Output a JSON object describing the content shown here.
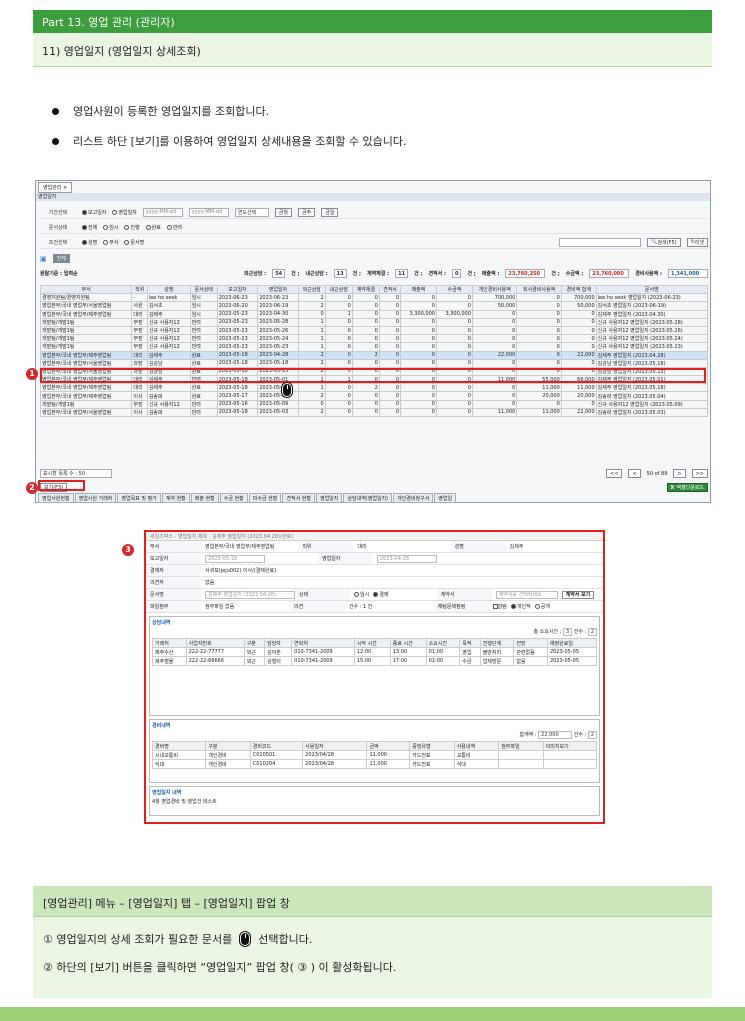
{
  "header": {
    "part": "Part 13. 영업 관리 (관리자)",
    "section": "11) 영업일지 (영업일지 상세조회)"
  },
  "bullets": [
    "영업사원이 등록한 영업일지를 조회합니다.",
    "리스트 하단 [보기]를 이용하여 영업일지 상세내용을 조회할 수 있습니다."
  ],
  "screen": {
    "tab": "영업관리 ×",
    "menu": "영업일지",
    "period_label": "기간선택",
    "period_opts": [
      "보고일자",
      "영업일자"
    ],
    "date_ph": "yyyy-MM-dd",
    "year_select": "연도선택",
    "btn_today": "금월",
    "btn_week": "금주",
    "btn_day": "금일",
    "doc_label": "문서상태",
    "doc_opts": [
      "전체",
      "임시",
      "진행",
      "완료",
      "반려"
    ],
    "cond_label": "조건선택",
    "cond_opts": [
      "성명",
      "부서",
      "문서명"
    ],
    "search_btn": "검색(F5)",
    "reset_btn": "리셋",
    "all_btn": "전체",
    "summary": {
      "base": "원탈기준 : 입력순",
      "visit_out": "외근상담 :",
      "visit_out_v": "54",
      "unit_case": "건 ;",
      "visit_in": "내근상담 :",
      "visit_in_v": "13",
      "contract": "계약체결 :",
      "contract_v": "11",
      "estimate": "견적서 :",
      "estimate_v": "0",
      "sales": "매출액 :",
      "sales_v": "23,760,250",
      "collect": "수금액 :",
      "collect_v": "23,760,000",
      "expense": "경비사용액 :",
      "expense_v": "1,341,000"
    },
    "columns": [
      "부서",
      "직위",
      "성명",
      "문서상태",
      "보고일자",
      "영업일자",
      "외근상담",
      "내근상담",
      "계약체결",
      "견적서",
      "매출액",
      "수금액",
      "개인경비사용액",
      "회사경비사용액",
      "경비액 합계",
      "문서명"
    ],
    "rows": [
      [
        "경영지원팀/경영지원팀",
        "-",
        "lee ho seok",
        "임시",
        "2023-06-23",
        "2023-06-23",
        "2",
        "0",
        "0",
        "0",
        "0",
        "0",
        "700,000",
        "0",
        "700,000",
        "lee ho seok 영업일지 (2023-06-23)"
      ],
      [
        "영업본부/국내 영업부/서울영업팀",
        "사원",
        "김서초",
        "임시",
        "2023-06-20",
        "2023-06-19",
        "2",
        "0",
        "0",
        "0",
        "0",
        "0",
        "50,000",
        "0",
        "50,000",
        "김서초 영업일지 (2023-06-19)"
      ],
      [
        "영업본부/국내 영업부/제주영업팀",
        "대리",
        "김제주",
        "임시",
        "2023-05-23",
        "2023-04-30",
        "0",
        "1",
        "0",
        "0",
        "3,300,000",
        "3,300,000",
        "0",
        "0",
        "0",
        "김제주 영업일지 (2023.04.30)"
      ],
      [
        "개발팀/개발1팀",
        "부장",
        "신규 사용자12",
        "반려",
        "2023-05-23",
        "2023-05-28",
        "1",
        "0",
        "0",
        "0",
        "0",
        "0",
        "0",
        "0",
        "0",
        "신규 사용자12 영업일지 (2023.05.28)"
      ],
      [
        "개발팀/개발1팀",
        "부장",
        "신규 사용자12",
        "반려",
        "2023-05-23",
        "2023-05-26",
        "1",
        "0",
        "0",
        "0",
        "0",
        "0",
        "0",
        "0",
        "0",
        "신규 사용자12 영업일지 (2023.05.26)"
      ],
      [
        "개발팀/개발1팀",
        "부장",
        "신규 사용자12",
        "반려",
        "2023-05-23",
        "2023-05-24",
        "1",
        "0",
        "0",
        "0",
        "0",
        "0",
        "0",
        "0",
        "0",
        "신규 사용자12 영업일지 (2023.05.24)"
      ],
      [
        "개발팀/개발1팀",
        "부장",
        "신규 사용자12",
        "반려",
        "2023-05-23",
        "2023-05-23",
        "1",
        "0",
        "0",
        "0",
        "0",
        "0",
        "0",
        "0",
        "0",
        "신규 사용자12 영업일지 (2023.05.23)"
      ],
      [
        "영업본부/국내 영업부/제주영업팀",
        "대리",
        "김제주",
        "완료",
        "2023-05-18",
        "2023-04-28",
        "2",
        "0",
        "2",
        "0",
        "0",
        "0",
        "22,000",
        "0",
        "22,000",
        "김제주 영업일지 (2023.04.28)"
      ],
      [
        "영업본부/국내 영업부/서울영업팀",
        "과장",
        "김강남",
        "완료",
        "2023-05-18",
        "2023-05-18",
        "2",
        "0",
        "0",
        "0",
        "0",
        "0",
        "0",
        "0",
        "0",
        "김강남 영업일지 (2023.05.18)"
      ],
      [
        "영업본부/국내 영업부/서울영업팀",
        "과장",
        "김강남",
        "완료",
        "2023-05-18",
        "2023-05-15",
        "2",
        "0",
        "0",
        "0",
        "0",
        "0",
        "0",
        "0",
        "0",
        "김강남 영업일지 (2023.05.15)"
      ],
      [
        "영업본부/국내 영업부/제주영업팀",
        "대리",
        "김제주",
        "반려",
        "2023-05-18",
        "2023-05-01",
        "1",
        "1",
        "0",
        "0",
        "0",
        "0",
        "11,000",
        "55,000",
        "66,000",
        "김제주 영업일지 (2023.05.01)"
      ],
      [
        "영업본부/국내 영업부/제주영업팀",
        "대리",
        "김제주",
        "완료",
        "2023-05-18",
        "2023-05-18",
        "1",
        "0",
        "2",
        "0",
        "0",
        "0",
        "0",
        "11,000",
        "11,000",
        "김제주 영업일지 (2023.05.18)"
      ],
      [
        "영업본부/국내 영업부/제주영업팀",
        "이사",
        "김송파",
        "완료",
        "2023-05-17",
        "2023-05-04",
        "2",
        "0",
        "0",
        "0",
        "0",
        "0",
        "0",
        "20,000",
        "20,000",
        "김송파 영업일지 (2023.05.04)"
      ],
      [
        "개발팀/개발1팀",
        "부장",
        "신규 사용자12",
        "반려",
        "2023-05-16",
        "2023-05-09",
        "0",
        "0",
        "0",
        "0",
        "0",
        "0",
        "0",
        "0",
        "0",
        "신규 사용자12 영업일지 (2023.05.09)"
      ],
      [
        "영업본부/국내 영업부/서울영업팀",
        "이사",
        "김송파",
        "반려",
        "2023-05-18",
        "2023-05-03",
        "2",
        "0",
        "0",
        "0",
        "0",
        "0",
        "11,000",
        "11,000",
        "22,000",
        "김송파 영업일지 (2023.05.03)"
      ]
    ],
    "rows_per_page": "표시할 목록 수 : 50",
    "pager": "50 of 89",
    "excel_btn": "엑셀다운로드",
    "view_btn": "보기(F3)",
    "bottom_tabs": [
      "영업사원현황",
      "영업사원 거래처",
      "영업목표 및 평가",
      "계약 현황",
      "매출 현황",
      "수금 현황",
      "미수금 현황",
      "견적서 현황",
      "영업일지",
      "상담내역(영업일지)",
      "개인경비청구서",
      "영업일"
    ]
  },
  "popup": {
    "title": "세일즈박스 - 영업일지 제목 : 김제주 영업일지 (2023.04.28)(완료)",
    "dept_l": "부서",
    "dept_v": "영업본부/국내 영업부/제주영업팀",
    "pos_l": "직위",
    "pos_v": "대리",
    "name_l": "성명",
    "name_v": "김제주",
    "report_l": "보고일자",
    "report_v": "2023-05-18",
    "sales_l": "영업일자",
    "sales_v": "2023-04-28",
    "approver_l": "결재자",
    "approver_v": "서귀포(jeju002) 이사/(결재완료)",
    "opinion_l": "의견자",
    "opinion_v": "없음",
    "docname_l": "문서명",
    "docname_v": "김제주 영업일지 (2023.04.28)",
    "state_l": "상태",
    "state_opts": [
      "임시",
      "결재"
    ],
    "contract_l": "계약서",
    "contract_ph": "계약서를 선택하세요",
    "contract_btn": "계약서 보기",
    "attach_l": "파일첨부",
    "attach_v": "첨부파일 없음",
    "opinion2_l": "의견",
    "opinion2_v": "건수 : 1 건",
    "share_l": "채팅문제참됨",
    "share_opts": [
      "알림",
      "개인적",
      "공개"
    ],
    "consult_title": "상담내역",
    "consult_sum": "총 소요시간 :",
    "consult_sum_v": "3",
    "consult_cnt": "건수 :",
    "consult_cnt_v": "2",
    "consult_cols": [
      "거래처",
      "사업자번호",
      "구분",
      "담당자",
      "연락처",
      "시작 시간",
      "종료 시간",
      "소요시간",
      "목적",
      "진행단계",
      "전망",
      "예정완료일"
    ],
    "consult_rows": [
      [
        "제주수산",
        "222-22-77777",
        "외근",
        "김어촌",
        "010-7341-2009",
        "12:00",
        "13:00",
        "01:00",
        "영업",
        "불만처리",
        "관련없음",
        "2023-05-05"
      ],
      [
        "제주철물",
        "222-22-66666",
        "외근",
        "김철리",
        "010-7341-2009",
        "15:00",
        "17:00",
        "02:00",
        "수금",
        "업체방문",
        "없음",
        "2023-05-05"
      ]
    ],
    "expense_title": "경비내역",
    "expense_sum": "합계액 :",
    "expense_sum_v": "22,000",
    "expense_cnt": "건수 :",
    "expense_cnt_v": "2",
    "expense_cols": [
      "경비명",
      "구분",
      "경비코드",
      "사용일자",
      "금액",
      "증빙유형",
      "사용내역",
      "첨부파일",
      "이미지보기"
    ],
    "expense_rows": [
      [
        "시내교통비",
        "개인경비",
        "C010501",
        "2023/04/28",
        "11,000",
        "카드전표",
        "교통비",
        "",
        ""
      ],
      [
        "식대",
        "개인경비",
        "C010204",
        "2023/04/28",
        "11,000",
        "카드전표",
        "식대",
        "",
        ""
      ]
    ],
    "journal_title": "영업일지 내역",
    "journal_text": "4월 영업경비 및 영업건 테스트"
  },
  "bottom": {
    "title": "[영업관리] 메뉴 – [영업일지] 탭 – [영업일지] 팝업 창",
    "line1_a": "① 영업일지의 상세 조회가 필요한 문서를",
    "line1_b": "선택합니다.",
    "line2": "② 하단의 [보기] 버튼을 클릭하면 “영업일지” 팝업 창( ③ ) 이 활성화됩니다."
  },
  "markers": {
    "m1": "1",
    "m2": "2",
    "m3": "3"
  }
}
